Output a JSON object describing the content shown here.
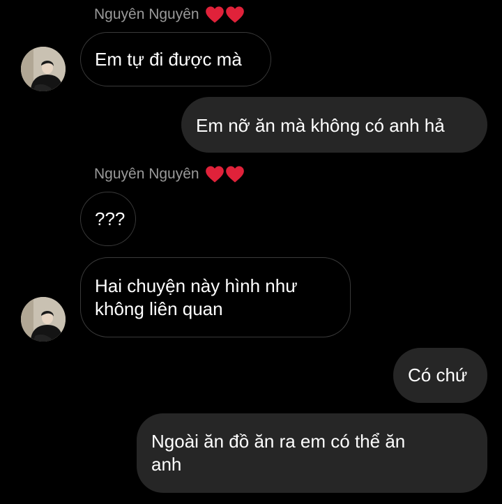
{
  "conversation": {
    "messages": [
      {
        "sender": "Nguyên Nguyên",
        "text": "Em tự đi được mà"
      },
      {
        "text": "Em nỡ ăn mà không có anh hả"
      },
      {
        "sender": "Nguyên Nguyên",
        "text": "???"
      },
      {
        "lines": [
          "Hai chuyện này hình như",
          "không liên quan"
        ]
      },
      {
        "text": "Có chứ"
      },
      {
        "lines": [
          "Ngoài ăn đồ ăn ra em có thể ăn",
          "anh"
        ]
      }
    ]
  },
  "colors": {
    "background": "#000000",
    "outgoing_bubble": "#262626",
    "incoming_border": "#3a3a3a",
    "sender_name": "#9a9a9a",
    "heart": "#e0223a"
  },
  "icons": {
    "heart": "red-heart-icon",
    "avatar": "profile-avatar"
  }
}
